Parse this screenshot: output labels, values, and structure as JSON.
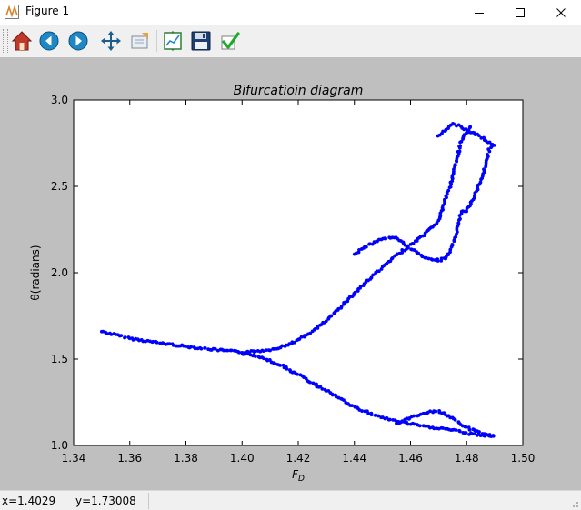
{
  "window": {
    "title": "Figure 1",
    "controls": [
      "minimize",
      "maximize",
      "close"
    ]
  },
  "toolbar": {
    "buttons": [
      {
        "name": "home",
        "icon": "home-icon"
      },
      {
        "name": "back",
        "icon": "back-arrow-icon"
      },
      {
        "name": "forward",
        "icon": "forward-arrow-icon"
      },
      {
        "name": "pan",
        "icon": "pan-arrows-icon"
      },
      {
        "name": "zoom",
        "icon": "zoom-rect-icon"
      },
      {
        "name": "subplots",
        "icon": "subplots-icon"
      },
      {
        "name": "save",
        "icon": "floppy-disk-icon"
      },
      {
        "name": "edit-parameters",
        "icon": "checkmark-icon"
      }
    ]
  },
  "status": {
    "x_text": "x=1.4029",
    "y_text": "y=1.73008"
  },
  "colors": {
    "figure_bg": "#bfbfbf",
    "axes_bg": "#ffffff",
    "marker": "#0000ff"
  },
  "chart_data": {
    "type": "scatter",
    "title": "Bifurcatioin diagram",
    "xlabel": "F_D",
    "ylabel": "θ(radians)",
    "xlim": [
      1.34,
      1.5
    ],
    "ylim": [
      1.0,
      3.0
    ],
    "xticks": [
      "1.34",
      "1.36",
      "1.38",
      "1.40",
      "1.42",
      "1.44",
      "1.46",
      "1.48",
      "1.50"
    ],
    "yticks": [
      "1.0",
      "1.5",
      "2.0",
      "2.5",
      "3.0"
    ],
    "grid": false,
    "series": [
      {
        "marker": "dot",
        "color": "#0000ff",
        "branches": [
          {
            "points": [
              [
                1.35,
                1.66
              ],
              [
                1.36,
                1.62
              ],
              [
                1.37,
                1.595
              ],
              [
                1.38,
                1.573
              ],
              [
                1.39,
                1.555
              ],
              [
                1.4,
                1.54
              ]
            ]
          },
          {
            "points": [
              [
                1.4,
                1.54
              ],
              [
                1.405,
                1.545
              ],
              [
                1.41,
                1.555
              ],
              [
                1.415,
                1.575
              ],
              [
                1.42,
                1.61
              ],
              [
                1.425,
                1.66
              ],
              [
                1.43,
                1.72
              ],
              [
                1.435,
                1.8
              ],
              [
                1.44,
                1.88
              ],
              [
                1.445,
                1.96
              ],
              [
                1.45,
                2.03
              ],
              [
                1.455,
                2.1
              ],
              [
                1.46,
                2.16
              ],
              [
                1.465,
                2.22
              ],
              [
                1.47,
                2.3
              ],
              [
                1.472,
                2.4
              ],
              [
                1.474,
                2.5
              ],
              [
                1.476,
                2.62
              ],
              [
                1.478,
                2.75
              ],
              [
                1.48,
                2.82
              ],
              [
                1.482,
                2.85
              ]
            ]
          },
          {
            "points": [
              [
                1.44,
                2.11
              ],
              [
                1.445,
                2.16
              ],
              [
                1.45,
                2.2
              ],
              [
                1.455,
                2.2
              ],
              [
                1.46,
                2.14
              ],
              [
                1.465,
                2.09
              ],
              [
                1.47,
                2.07
              ],
              [
                1.473,
                2.09
              ],
              [
                1.476,
                2.2
              ],
              [
                1.478,
                2.35
              ],
              [
                1.48,
                2.36
              ],
              [
                1.483,
                2.45
              ],
              [
                1.486,
                2.58
              ],
              [
                1.488,
                2.71
              ],
              [
                1.49,
                2.75
              ]
            ]
          },
          {
            "points": [
              [
                1.47,
                2.79
              ],
              [
                1.475,
                2.86
              ],
              [
                1.478,
                2.85
              ],
              [
                1.48,
                2.82
              ],
              [
                1.484,
                2.8
              ],
              [
                1.487,
                2.76
              ],
              [
                1.49,
                2.74
              ]
            ]
          },
          {
            "points": [
              [
                1.4,
                1.53
              ],
              [
                1.405,
                1.52
              ],
              [
                1.41,
                1.49
              ],
              [
                1.415,
                1.455
              ],
              [
                1.42,
                1.41
              ],
              [
                1.425,
                1.36
              ],
              [
                1.43,
                1.32
              ],
              [
                1.435,
                1.27
              ],
              [
                1.44,
                1.22
              ],
              [
                1.445,
                1.19
              ],
              [
                1.45,
                1.16
              ],
              [
                1.455,
                1.14
              ],
              [
                1.46,
                1.125
              ],
              [
                1.465,
                1.11
              ],
              [
                1.47,
                1.1
              ],
              [
                1.475,
                1.09
              ],
              [
                1.48,
                1.07
              ],
              [
                1.485,
                1.06
              ],
              [
                1.49,
                1.05
              ]
            ]
          },
          {
            "points": [
              [
                1.455,
                1.13
              ],
              [
                1.46,
                1.16
              ],
              [
                1.465,
                1.19
              ],
              [
                1.47,
                1.2
              ],
              [
                1.475,
                1.16
              ],
              [
                1.478,
                1.12
              ],
              [
                1.482,
                1.09
              ],
              [
                1.486,
                1.07
              ],
              [
                1.49,
                1.05
              ]
            ]
          }
        ]
      }
    ]
  }
}
